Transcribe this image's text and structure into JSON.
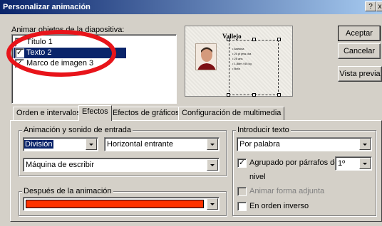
{
  "window": {
    "title": "Personalizar animación",
    "help_button": "?",
    "close_button": "x"
  },
  "objects": {
    "label": "Animar objetos de la diapositiva:",
    "items": [
      {
        "label": "Título 1",
        "checked": true,
        "selected": false
      },
      {
        "label": "Texto 2",
        "checked": true,
        "selected": true
      },
      {
        "label": "Marco de imagen 3",
        "checked": true,
        "selected": false
      }
    ]
  },
  "preview": {
    "slide_title": "Vallejo",
    "bullets": [
      "Asesina",
      "20 pi jess dra",
      "25 ans",
      "1,88m / 65 kg",
      "Bofa"
    ]
  },
  "buttons": {
    "accept": "Aceptar",
    "cancel": "Cancelar",
    "preview": "Vista previa"
  },
  "tabs": [
    {
      "label": "Orden e intervalos",
      "active": false
    },
    {
      "label": "Efectos",
      "active": true
    },
    {
      "label": "Efectos de gráficos",
      "active": false
    },
    {
      "label": "Configuración de multimedia",
      "active": false
    }
  ],
  "entry": {
    "group_label": "Animación y sonido de entrada",
    "effect": "División",
    "direction": "Horizontal entrante",
    "sound": "Máquina de escribir"
  },
  "after": {
    "group_label": "Después de la animación",
    "color": "#ff3300"
  },
  "intro_text": {
    "group_label": "Introducir texto",
    "by": "Por palabra",
    "grouped_label": "Agrupado por párrafos de",
    "grouped_checked": true,
    "level_value": "1º",
    "level_label": "nivel",
    "animate_shape": "Animar forma adjunta",
    "animate_shape_checked": false,
    "reverse_order": "En orden inverso",
    "reverse_order_checked": false
  },
  "annotation": {
    "color": "#e8141a"
  }
}
